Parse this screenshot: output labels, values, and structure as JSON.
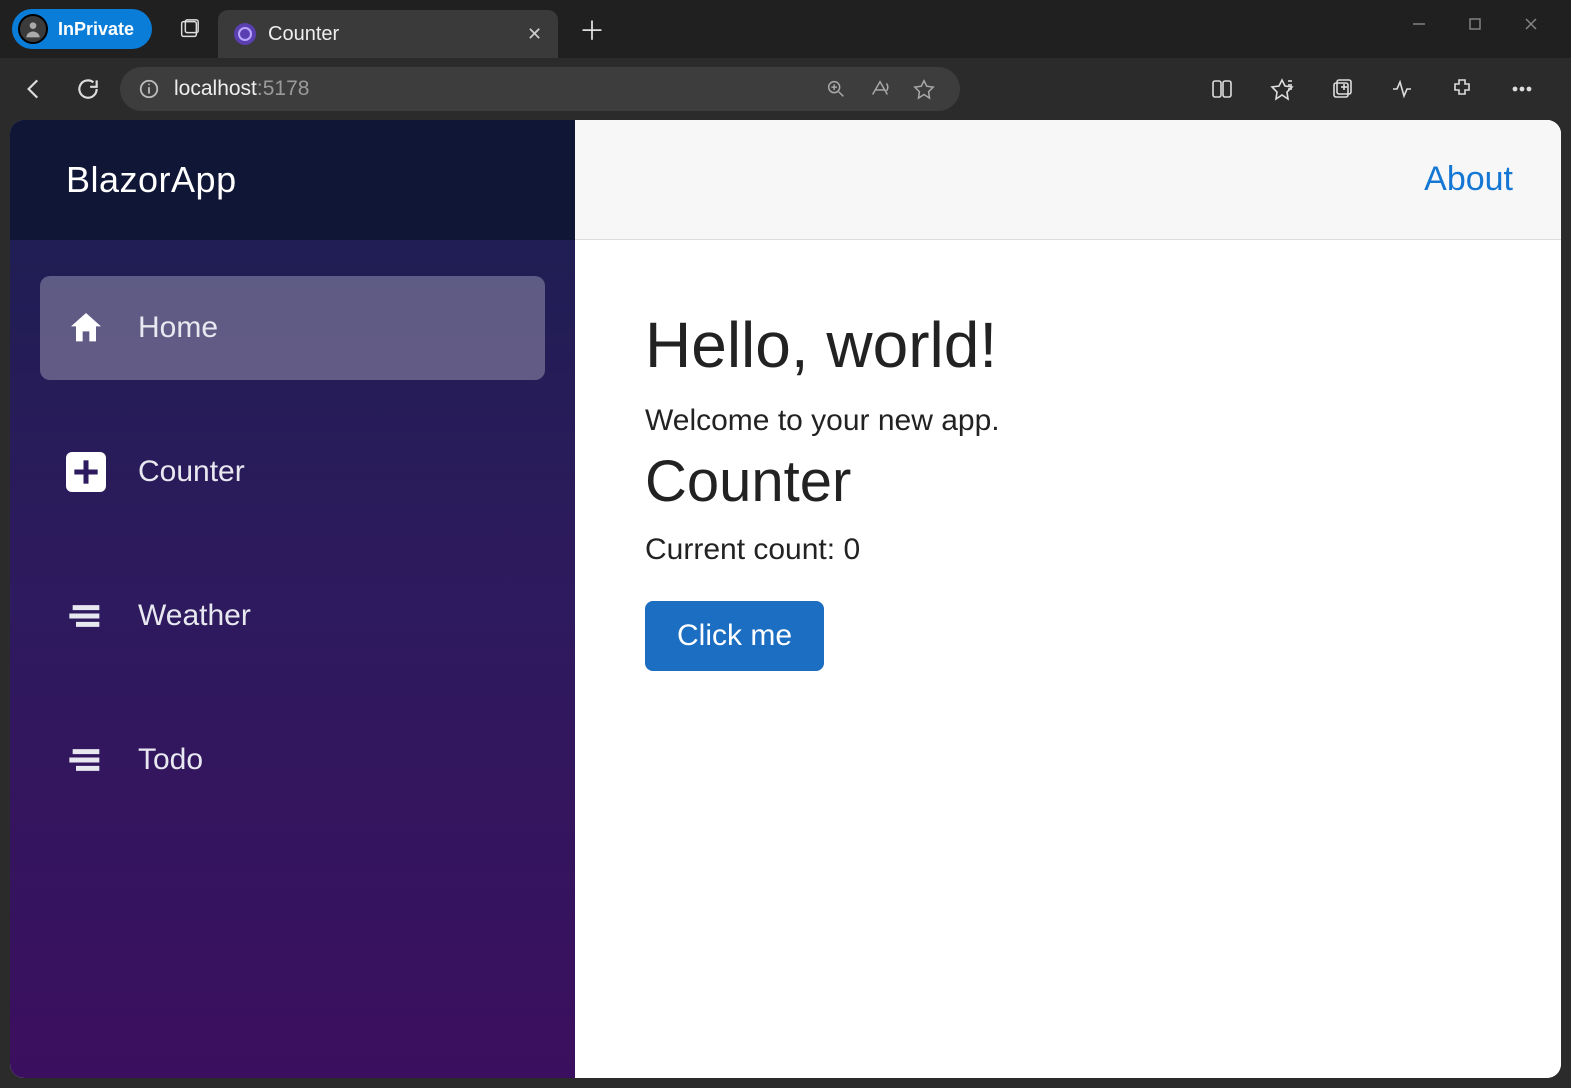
{
  "browser": {
    "inprivate_label": "InPrivate",
    "tab_title": "Counter",
    "url_host": "localhost",
    "url_port": ":5178"
  },
  "sidebar": {
    "brand": "BlazorApp",
    "items": [
      {
        "label": "Home"
      },
      {
        "label": "Counter"
      },
      {
        "label": "Weather"
      },
      {
        "label": "Todo"
      }
    ]
  },
  "header": {
    "about_label": "About"
  },
  "page": {
    "hello_heading": "Hello, world!",
    "welcome_text": "Welcome to your new app.",
    "counter_heading": "Counter",
    "count_label_prefix": "Current count: ",
    "count_value": "0",
    "button_label": "Click me"
  }
}
